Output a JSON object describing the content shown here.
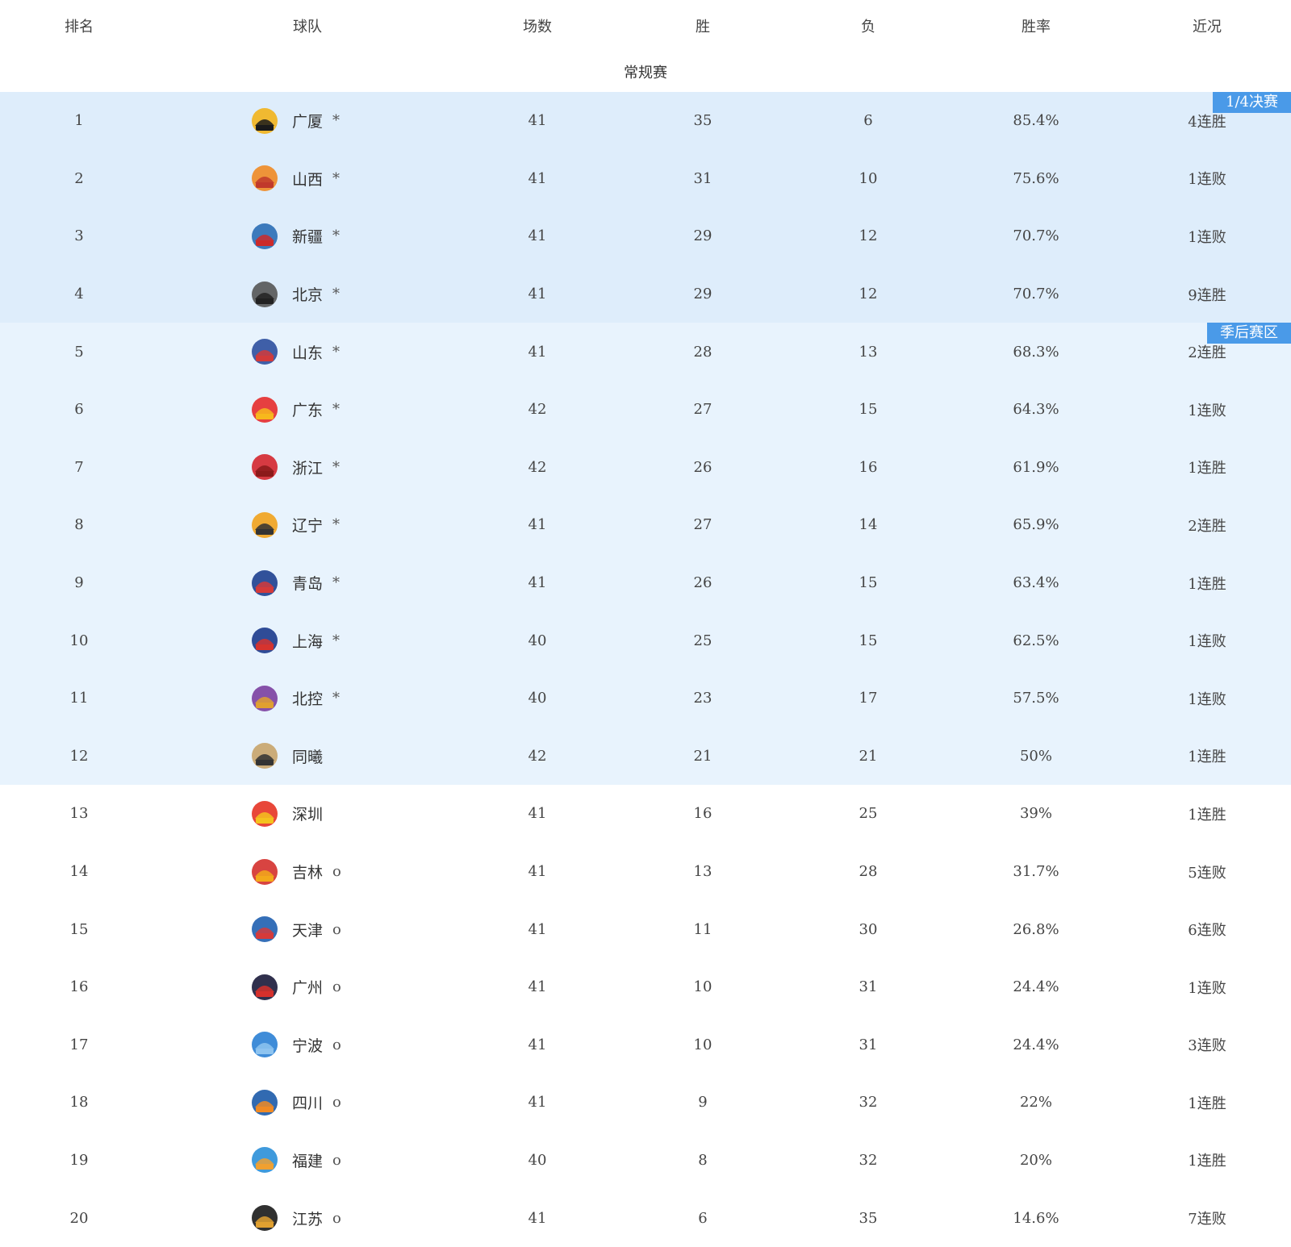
{
  "columns": {
    "rank": "排名",
    "team": "球队",
    "games": "场数",
    "wins": "胜",
    "losses": "负",
    "win_rate": "胜率",
    "form": "近况"
  },
  "section_title": "常规赛",
  "zones": {
    "quarterfinal": {
      "label": "1/4决赛",
      "color": "#deedfb"
    },
    "playoff": {
      "label": "季后赛区",
      "color": "#e8f3fd"
    }
  },
  "accent_color": "#4a9ae8",
  "teams": [
    {
      "rank": "1",
      "name": "广厦",
      "mark": "*",
      "games": "41",
      "wins": "35",
      "losses": "6",
      "rate": "85.4%",
      "form": "4连胜",
      "zone": "quarter",
      "logo": "guangsha-lion-logo",
      "c1": "#f2b21b",
      "c2": "#1a1a1a"
    },
    {
      "rank": "2",
      "name": "山西",
      "mark": "*",
      "games": "41",
      "wins": "31",
      "losses": "10",
      "rate": "75.6%",
      "form": "1连败",
      "zone": "quarter",
      "logo": "shanxi-loongs-logo",
      "c1": "#f08a24",
      "c2": "#c0392b"
    },
    {
      "rank": "3",
      "name": "新疆",
      "mark": "*",
      "games": "41",
      "wins": "29",
      "losses": "12",
      "rate": "70.7%",
      "form": "1连败",
      "zone": "quarter",
      "logo": "xinjiang-tigers-logo",
      "c1": "#2a6db5",
      "c2": "#cc2a2a"
    },
    {
      "rank": "4",
      "name": "北京",
      "mark": "*",
      "games": "41",
      "wins": "29",
      "losses": "12",
      "rate": "70.7%",
      "form": "9连胜",
      "zone": "quarter",
      "logo": "beijing-ducks-logo",
      "c1": "#555555",
      "c2": "#222222"
    },
    {
      "rank": "5",
      "name": "山东",
      "mark": "*",
      "games": "41",
      "wins": "28",
      "losses": "13",
      "rate": "68.3%",
      "form": "2连胜",
      "zone": "playoff",
      "logo": "shandong-logo",
      "c1": "#2c4f9e",
      "c2": "#d23a3a"
    },
    {
      "rank": "6",
      "name": "广东",
      "mark": "*",
      "games": "42",
      "wins": "27",
      "losses": "15",
      "rate": "64.3%",
      "form": "1连败",
      "zone": "playoff",
      "logo": "guangdong-tigers-logo",
      "c1": "#e52b2b",
      "c2": "#f7b81c"
    },
    {
      "rank": "7",
      "name": "浙江",
      "mark": "*",
      "games": "42",
      "wins": "26",
      "losses": "16",
      "rate": "61.9%",
      "form": "1连胜",
      "zone": "playoff",
      "logo": "zhejiang-golden-bulls-logo",
      "c1": "#d4262e",
      "c2": "#8b1a1a"
    },
    {
      "rank": "8",
      "name": "辽宁",
      "mark": "*",
      "games": "41",
      "wins": "27",
      "losses": "14",
      "rate": "65.9%",
      "form": "2连胜",
      "zone": "playoff",
      "logo": "liaoning-flying-leopards-logo",
      "c1": "#f1a21c",
      "c2": "#333333"
    },
    {
      "rank": "9",
      "name": "青岛",
      "mark": "*",
      "games": "41",
      "wins": "26",
      "losses": "15",
      "rate": "63.4%",
      "form": "1连胜",
      "zone": "playoff",
      "logo": "qingdao-eagles-logo",
      "c1": "#1d3f8f",
      "c2": "#d43a3a"
    },
    {
      "rank": "10",
      "name": "上海",
      "mark": "*",
      "games": "40",
      "wins": "25",
      "losses": "15",
      "rate": "62.5%",
      "form": "1连败",
      "zone": "playoff",
      "logo": "shanghai-sharks-logo",
      "c1": "#1b3a8c",
      "c2": "#d6332e"
    },
    {
      "rank": "11",
      "name": "北控",
      "mark": "*",
      "games": "40",
      "wins": "23",
      "losses": "17",
      "rate": "57.5%",
      "form": "1连败",
      "zone": "playoff",
      "logo": "beikong-fly-dragons-logo",
      "c1": "#7b3fa0",
      "c2": "#e0a030"
    },
    {
      "rank": "12",
      "name": "同曦",
      "mark": "",
      "games": "42",
      "wins": "21",
      "losses": "21",
      "rate": "50%",
      "form": "1连胜",
      "zone": "playoff",
      "logo": "tongxi-monkey-kings-logo",
      "c1": "#c8a46a",
      "c2": "#333333"
    },
    {
      "rank": "13",
      "name": "深圳",
      "mark": "",
      "games": "41",
      "wins": "16",
      "losses": "25",
      "rate": "39%",
      "form": "1连胜",
      "zone": "none",
      "logo": "shenzhen-leopards-logo",
      "c1": "#e53323",
      "c2": "#f4c21e"
    },
    {
      "rank": "14",
      "name": "吉林",
      "mark": "o",
      "games": "41",
      "wins": "13",
      "losses": "28",
      "rate": "31.7%",
      "form": "5连败",
      "zone": "none",
      "logo": "jilin-tigers-logo",
      "c1": "#d4302c",
      "c2": "#f3a91b"
    },
    {
      "rank": "15",
      "name": "天津",
      "mark": "o",
      "games": "41",
      "wins": "11",
      "losses": "30",
      "rate": "26.8%",
      "form": "6连败",
      "zone": "none",
      "logo": "tianjin-pioneers-logo",
      "c1": "#1f5fb0",
      "c2": "#d63a3a"
    },
    {
      "rank": "16",
      "name": "广州",
      "mark": "o",
      "games": "41",
      "wins": "10",
      "losses": "31",
      "rate": "24.4%",
      "form": "1连败",
      "zone": "none",
      "logo": "guangzhou-loong-lions-logo",
      "c1": "#1a1a3a",
      "c2": "#d6302c"
    },
    {
      "rank": "17",
      "name": "宁波",
      "mark": "o",
      "games": "41",
      "wins": "10",
      "losses": "31",
      "rate": "24.4%",
      "form": "3连败",
      "zone": "none",
      "logo": "ningbo-rockets-logo",
      "c1": "#2a7fd4",
      "c2": "#8ec4f0"
    },
    {
      "rank": "18",
      "name": "四川",
      "mark": "o",
      "games": "41",
      "wins": "9",
      "losses": "32",
      "rate": "22%",
      "form": "1连胜",
      "zone": "none",
      "logo": "sichuan-blue-whales-logo",
      "c1": "#1b5aa8",
      "c2": "#f08a24"
    },
    {
      "rank": "19",
      "name": "福建",
      "mark": "o",
      "games": "40",
      "wins": "8",
      "losses": "32",
      "rate": "20%",
      "form": "1连胜",
      "zone": "none",
      "logo": "fujian-sturgeons-logo",
      "c1": "#2a8fd8",
      "c2": "#f0a030"
    },
    {
      "rank": "20",
      "name": "江苏",
      "mark": "o",
      "games": "41",
      "wins": "6",
      "losses": "35",
      "rate": "14.6%",
      "form": "7连败",
      "zone": "none",
      "logo": "jiangsu-dragons-logo",
      "c1": "#1a1a1a",
      "c2": "#e0a030"
    }
  ]
}
